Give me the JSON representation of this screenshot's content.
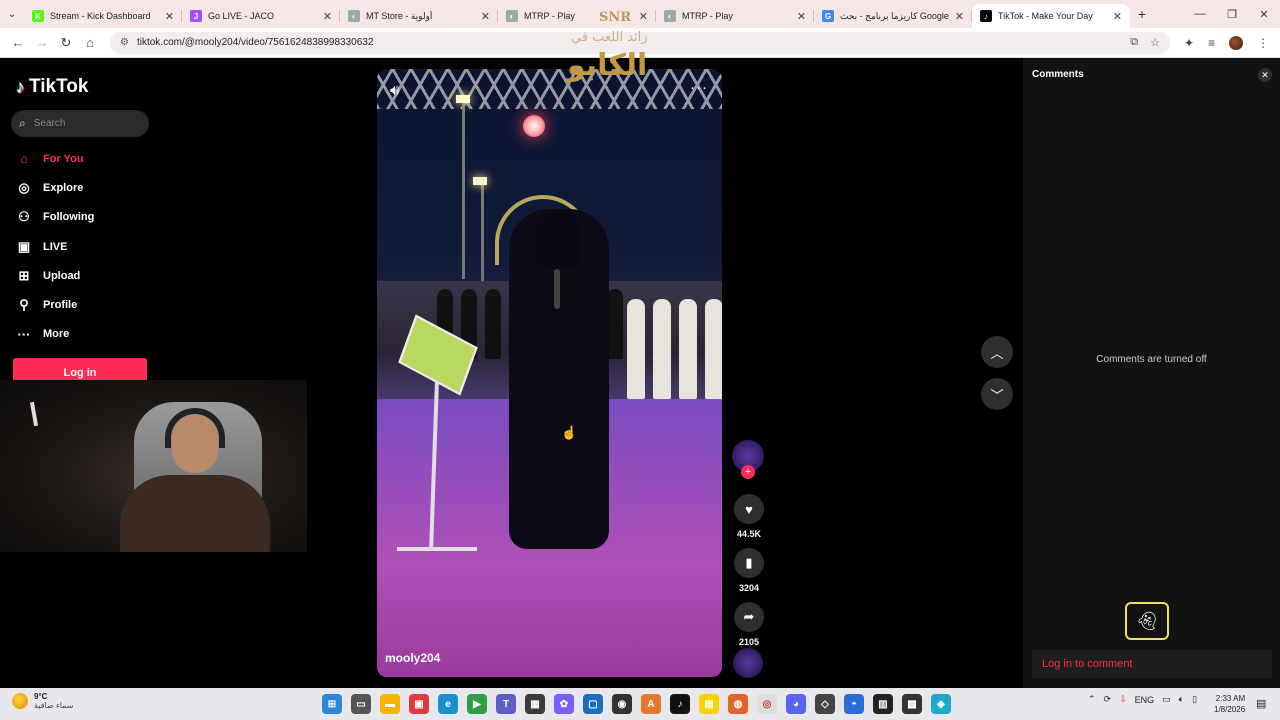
{
  "browser": {
    "tabs": [
      {
        "title": "Stream - Kick Dashboard",
        "fav": "K",
        "fav_color": "#53fc18",
        "active": false
      },
      {
        "title": "Go LIVE - JACO",
        "fav": "J",
        "fav_color": "#a64dff",
        "active": false
      },
      {
        "title": "MT Store - أولوية",
        "fav": "◐",
        "fav_color": "#9aa",
        "active": false
      },
      {
        "title": "MTRP - Play",
        "fav": "◐",
        "fav_color": "#9aa",
        "active": false
      },
      {
        "title": "MTRP - Play",
        "fav": "◐",
        "fav_color": "#9aa",
        "active": false
      },
      {
        "title": "كاريزما برنامج - بحث Google",
        "fav": "G",
        "fav_color": "#4285f4",
        "active": false
      },
      {
        "title": "TikTok - Make Your Day",
        "fav": "♪",
        "fav_color": "#000000",
        "active": true
      }
    ],
    "url": "tiktok.com/@mooly204/video/7561624838998330632"
  },
  "tiktok": {
    "logo": "TikTok",
    "search_placeholder": "Search",
    "nav": [
      {
        "label": "For You",
        "icon": "home-icon",
        "active": true
      },
      {
        "label": "Explore",
        "icon": "compass-icon",
        "active": false
      },
      {
        "label": "Following",
        "icon": "following-icon",
        "active": false
      },
      {
        "label": "LIVE",
        "icon": "live-icon",
        "active": false
      },
      {
        "label": "Upload",
        "icon": "upload-icon",
        "active": false
      },
      {
        "label": "Profile",
        "icon": "profile-icon",
        "active": false
      },
      {
        "label": "More",
        "icon": "more-icon",
        "active": false
      }
    ],
    "login_label": "Log in",
    "video": {
      "author": "mooly204",
      "likes": "44.5K",
      "saves": "3204",
      "shares": "2105"
    },
    "comments": {
      "title": "Comments",
      "off_text": "Comments are turned off",
      "login_text": "Log in to comment"
    }
  },
  "watermark": {
    "stamp": "SNR",
    "line1": "زائد اللعب في",
    "line2": "الكابو"
  },
  "taskbar": {
    "weather_temp": "9°C",
    "weather_desc": "سماء صافية",
    "language": "ENG",
    "time": "2:33 AM",
    "date": "1/8/2026"
  },
  "colors": {
    "tiktok_accent": "#fe2c55",
    "active_tab_bg": "#ffffff",
    "tabstrip_bg": "#f6e6e6"
  }
}
